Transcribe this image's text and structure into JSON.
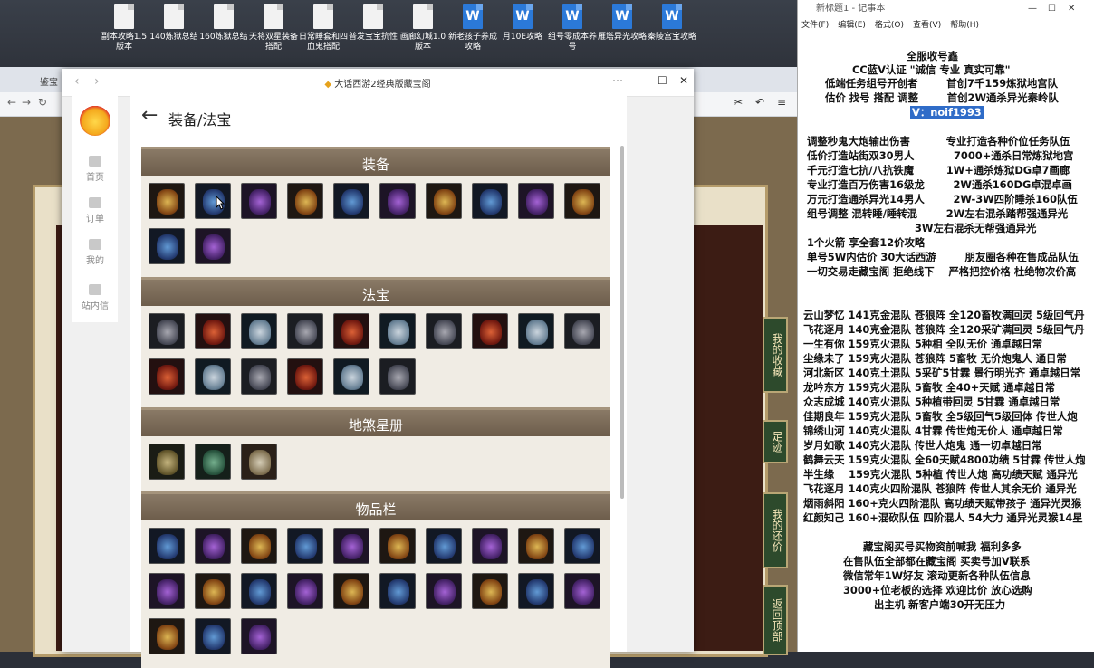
{
  "desktop": {
    "icons": [
      {
        "label": "副本攻略1.5版本",
        "type": "doc"
      },
      {
        "label": "140炼狱总结",
        "type": "doc"
      },
      {
        "label": "160炼狱总结",
        "type": "doc"
      },
      {
        "label": "天将双星装备搭配",
        "type": "doc"
      },
      {
        "label": "日常睡套和四血鬼搭配",
        "type": "doc"
      },
      {
        "label": "普发宝宝抗性",
        "type": "doc"
      },
      {
        "label": "画廊幻城1.0版本",
        "type": "doc"
      },
      {
        "label": "新老孩子养成攻略",
        "type": "word"
      },
      {
        "label": "月10E攻略",
        "type": "word"
      },
      {
        "label": "组号零成本养号",
        "type": "word"
      },
      {
        "label": "雁塔异光攻略",
        "type": "word"
      },
      {
        "label": "秦陵宫宝攻略",
        "type": "word"
      }
    ]
  },
  "background_browser": {
    "tab_label": "鉴宝",
    "side_buttons": [
      "我的收藏",
      "足迹",
      "我的还价",
      "返回顶部"
    ]
  },
  "notepad": {
    "title": "新标题1 - 记事本",
    "menu": [
      "文件(F)",
      "编辑(E)",
      "格式(O)",
      "查看(V)",
      "帮助(H)"
    ],
    "lines": [
      "全服收号鑫",
      "CC蓝V认证 \"诚信 专业 真实可靠\"",
      "低端任务组号开创者        首创7千159炼狱地宫队",
      "估价 找号 搭配 调整        首创2W通杀异光秦岭队",
      "V：noif1993",
      "调整秒鬼大炮输出伤害          专业打造各种价位任务队伍",
      "低价打造站街双30男人           7000+通杀日常炼狱地宫",
      "千元打造七抗/八抗铁魔         1W+通杀炼狱DG卓7画廊",
      "专业打造百万伤害16级龙        2W通杀160DG卓混卓画",
      "万元打造通杀异光14男人        2W-3W四阶睡杀160队伍",
      "组号调整 混转睡/睡转混        2W左右混杀踏帮强通异光",
      "                              3W左右混杀无帮强通异光",
      "1个火箭 享全套12价攻略",
      "单号5W内估价 30大话西游        朋友圈各种在售成品队伍",
      "一切交易走藏宝阁 拒绝线下    严格把控价格 杜绝物次价高",
      "云山梦忆 141克金混队 苍狼阵 全120畜牧满回灵 5级回气丹",
      "飞花逐月 140克金混队 苍狼阵 全120采矿满回灵 5级回气丹",
      "一生有你 159克火混队 5种相 全队无价 通卓越日常",
      "尘缘未了 159克火混队 苍狼阵 5畜牧 无价炮鬼人 通日常",
      "河北新区 140克土混队 5采矿5甘霖 景行明光齐 通卓越日常",
      "龙吟东方 159克火混队 5畜牧 全40+天赋 通卓越日常",
      "众志成城 140克火混队 5种植带回灵 5甘霖 通卓越日常",
      "佳期良年 159克火混队 5畜牧 全5级回气5级回体 传世人炮",
      "锦绣山河 140克火混队 4甘霖 传世炮无价人 通卓越日常",
      "岁月如歌 140克火混队 传世人炮鬼 通一切卓越日常",
      "鹤舞云天 159克火混队 全60天赋4800功绩 5甘霖 传世人炮",
      "半生缘    159克火混队 5种植 传世人炮 高功绩天赋 通异光",
      "飞花逐月 140克火四阶混队 苍狼阵 传世人其余无价 通异光",
      "烟雨斜阳 160+克火四阶混队 高功绩天赋带孩子 通异光灵猴",
      "红颜知己 160+混砍队伍 四阶混人 54大力 通异光灵猴14星",
      "藏宝阁买号买物资前喊我 福利多多",
      "在售队伍全部都在藏宝阁 买卖号加V联系",
      "微信常年1W好友 滚动更新各种队伍信息",
      "3000+位老板的选择 欢迎比价 放心选购",
      "出主机 新客户端30开无压力"
    ]
  },
  "window": {
    "title": "大话西游2经典版藏宝阁",
    "nav": [
      {
        "label": "首页"
      },
      {
        "label": "订单"
      },
      {
        "label": "我的"
      },
      {
        "label": "站内信"
      }
    ],
    "page_title": "装备/法宝",
    "sections": [
      {
        "title": "装备",
        "count": 12
      },
      {
        "title": "法宝",
        "count": 16
      },
      {
        "title": "地煞星册",
        "count": 3
      },
      {
        "title": "物品栏",
        "count": 23
      }
    ]
  }
}
